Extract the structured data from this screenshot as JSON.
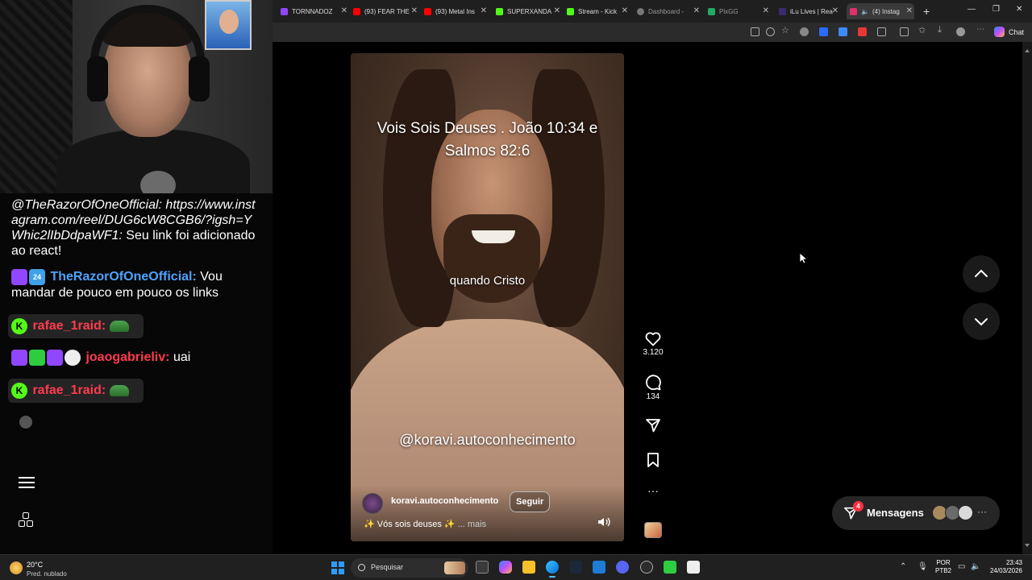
{
  "browser": {
    "tabs": [
      {
        "label": "TORNNADOZ",
        "favicon_color": "#9146ff",
        "active": false
      },
      {
        "label": "(93) FEAR THE",
        "favicon_color": "#ff0000",
        "active": false
      },
      {
        "label": "(93) Metal Ins",
        "favicon_color": "#ff0000",
        "active": false
      },
      {
        "label": "SUPERXANDA",
        "favicon_color": "#53fc18",
        "active": false
      },
      {
        "label": "Stream - Kick",
        "favicon_color": "#53fc18",
        "active": false
      },
      {
        "label": "Dashboard -",
        "favicon_color": "#777777",
        "active": false
      },
      {
        "label": "PixGG",
        "favicon_color": "#22aa66",
        "active": false
      },
      {
        "label": "iLu Lives | Rea",
        "favicon_color": "#3a2a70",
        "active": false
      },
      {
        "label": "(4) Instag",
        "favicon_color": "#e1306c",
        "active": true
      }
    ],
    "new_tab": "+",
    "chat_button": "Chat"
  },
  "stream_chat": {
    "msg1_italic": "@TheRazorOfOneOfficial: https://www.instagram.com/reel/DUG6cW8CGB6/?igsh=YWhic2lIbDdpaWF1:",
    "msg1_text": "Seu link foi adicionado ao react!",
    "msg2_user": "TheRazorOfOneOfficial:",
    "msg2_text": "Vou mandar de pouco em pouco os links",
    "msg3_user": "rafae_1raid:",
    "msg4_user": "joaogabrieliv:",
    "msg4_text": "uai",
    "msg5_user": "rafae_1raid:",
    "badge_sub_text": "24"
  },
  "reel": {
    "caption_top": "Vois Sois Deuses . João 10:34 e Salmos 82:6",
    "caption_mid": "quando Cristo",
    "caption_bottom": "@koravi.autoconhecimento",
    "username": "koravi.autoconhecimento",
    "follow_label": "Seguir",
    "description": "✨ Vós sois deuses ✨",
    "more_label": "... mais",
    "likes": "3.120",
    "comments": "134"
  },
  "messages": {
    "label": "Mensagens",
    "count": "4"
  },
  "taskbar": {
    "temperature": "20°C",
    "condition": "Pred. nublado",
    "search_placeholder": "Pesquisar",
    "lang_line1": "POR",
    "lang_line2": "PTB2",
    "time": "23:43",
    "date": "24/03/2026"
  },
  "colors": {
    "twitch": "#9146ff",
    "kick": "#53fc18",
    "username_blue": "#4ea2ff",
    "username_red": "#ff3b4e",
    "notification": "#ff3040"
  }
}
